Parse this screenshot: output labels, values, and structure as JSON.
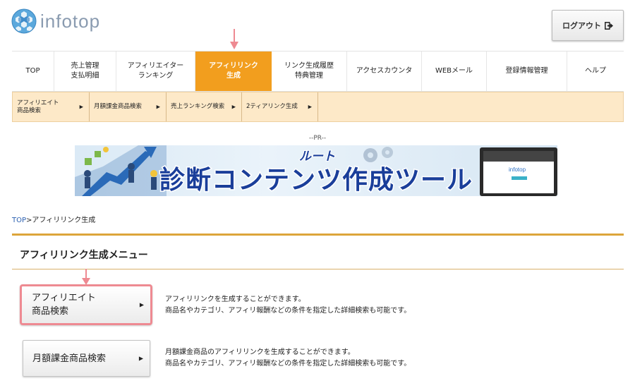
{
  "header": {
    "logo_text": "infotop",
    "logout_label": "ログアウト"
  },
  "main_nav": [
    {
      "label": "TOP"
    },
    {
      "label": "売上管理\n支払明細"
    },
    {
      "label": "アフィリエイター\nランキング"
    },
    {
      "label": "アフィリリンク\n生成",
      "active": true
    },
    {
      "label": "リンク生成履歴\n特典管理"
    },
    {
      "label": "アクセスカウンタ"
    },
    {
      "label": "WEBメール"
    },
    {
      "label": "登録情報管理"
    },
    {
      "label": "ヘルプ"
    }
  ],
  "sub_nav": [
    {
      "label": "アフィリエイト\n商品検索"
    },
    {
      "label": "月額課金商品検索"
    },
    {
      "label": "売上ランキング検索"
    },
    {
      "label": "2ティアリンク生成"
    }
  ],
  "pr_label": "--PR--",
  "banner": {
    "headline": "診断コンテンツ作成ツール",
    "sub_text": "ルート",
    "screen_logo": "infotop"
  },
  "breadcrumb": {
    "home": "TOP",
    "separator": ">",
    "current": "アフィリリンク生成"
  },
  "section_title": "アフィリリンク生成メニュー",
  "menu": [
    {
      "label": "アフィリエイト\n商品検索",
      "highlighted": true,
      "desc_line1": "アフィリリンクを生成することができます。",
      "desc_line2": "商品名やカテゴリ、アフィリ報酬などの条件を指定した詳細検索も可能です。"
    },
    {
      "label": "月額課金商品検索",
      "highlighted": false,
      "desc_line1": "月額課金商品のアフィリリンクを生成することができます。",
      "desc_line2": "商品名やカテゴリ、アフィリ報酬などの条件を指定した詳細検索も可能です。"
    }
  ],
  "colors": {
    "active_tab": "#f29e1e",
    "sub_nav_bg": "#fde9c8",
    "rule": "#dca53a",
    "annotation": "#ee8a92",
    "link": "#2a5fb0"
  }
}
